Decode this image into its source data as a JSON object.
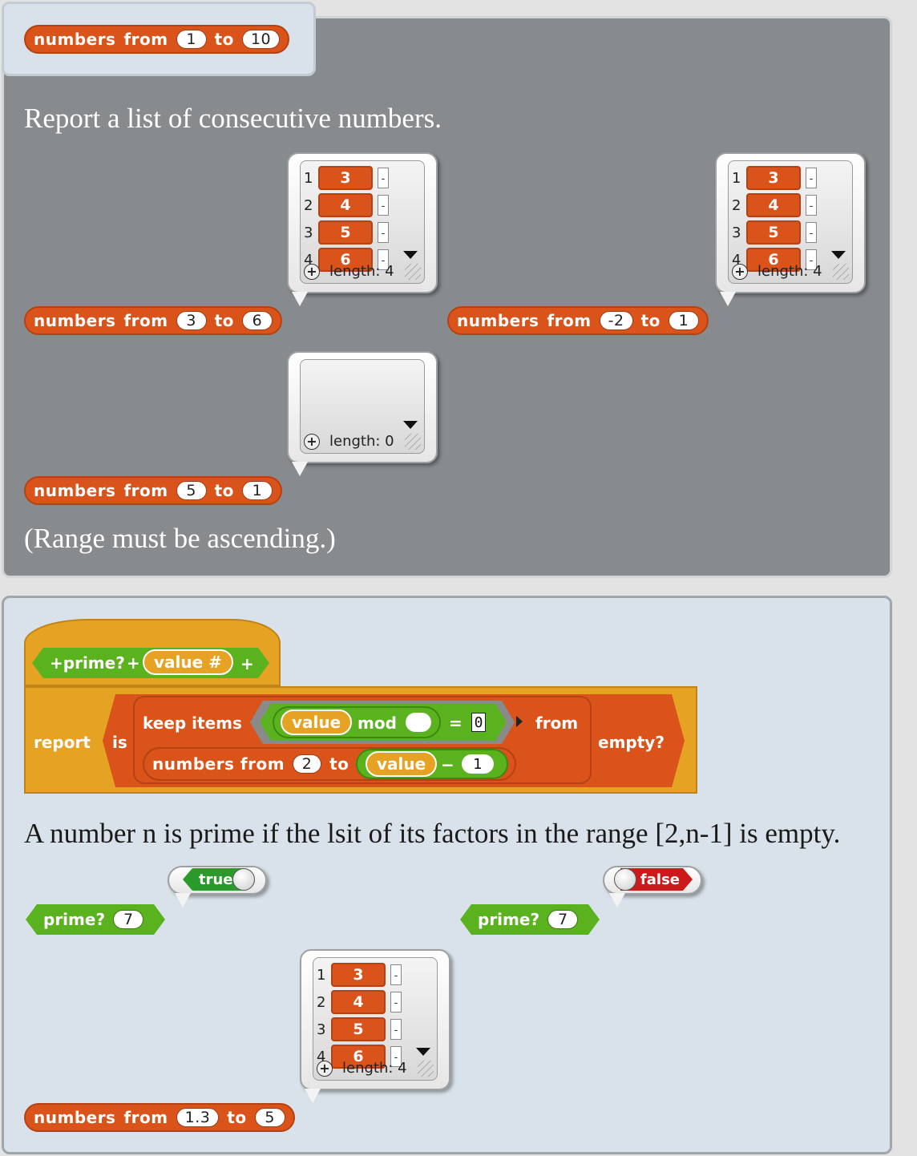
{
  "header_block": {
    "words": [
      "numbers",
      "from",
      "to"
    ],
    "from": "1",
    "to": "10"
  },
  "section1": {
    "description": "Report a list of consecutive numbers.",
    "example_a": {
      "from": "3",
      "to": "6"
    },
    "example_b": {
      "from": "-2",
      "to": "1"
    },
    "example_c": {
      "from": "5",
      "to": "1"
    },
    "list_result": {
      "items": [
        "3",
        "4",
        "5",
        "6"
      ],
      "indices": [
        "1",
        "2",
        "3",
        "4"
      ],
      "length_label": "length: 4",
      "minus": "-"
    },
    "empty_result": {
      "length_label": "length: 0"
    },
    "note": "(Range must be ascending.)"
  },
  "section2": {
    "definition": {
      "hat_prefix": "+",
      "name": "prime?",
      "param": "value #",
      "report": "report",
      "is": "is",
      "keep": "keep items",
      "value_var": "value",
      "mod": "mod",
      "eq": "=",
      "eq_value": "0",
      "from": "from",
      "empty": "empty?",
      "numbers_from": "numbers from",
      "num_from": "2",
      "to": "to",
      "minus": "−",
      "minus_value": "1"
    },
    "description": "A number n is prime if the lsit of its factors in the range [2,n-1] is empty.",
    "prime_a": {
      "label": "prime?",
      "arg": "7",
      "result": "true"
    },
    "prime_b": {
      "label": "prime?",
      "arg": "7",
      "result": "false"
    },
    "example_d": {
      "from": "1.3",
      "to": "5"
    }
  },
  "colors": {
    "list_orange": "#d9531b",
    "control_gold": "#e6a223",
    "operator_green": "#5bb21f",
    "panel_gray": "#878b8e",
    "panel_blue": "#d9e2ea"
  }
}
